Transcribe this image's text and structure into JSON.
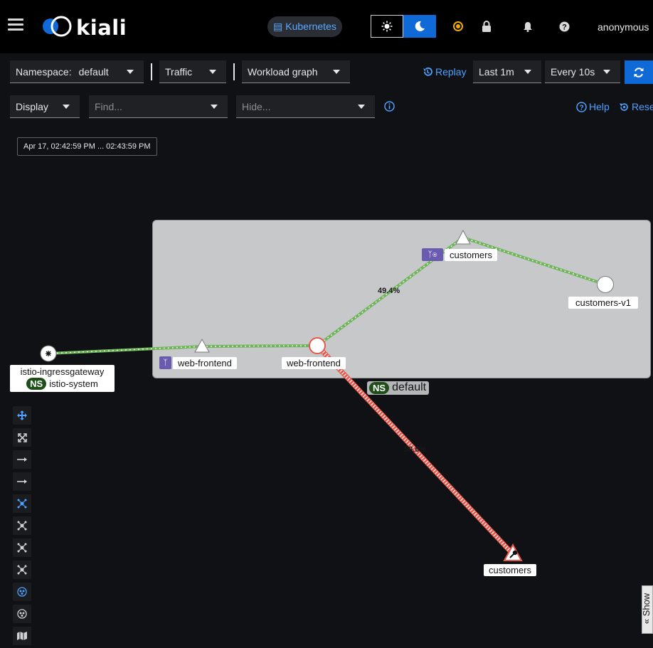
{
  "header": {
    "logo": "kiali",
    "cluster_label": "Kubernetes",
    "username": "anonymous",
    "icons": [
      "menu-icon",
      "sun-icon",
      "moon-icon",
      "status-icon",
      "lock-icon",
      "bell-icon",
      "help-icon"
    ],
    "accent": "#0f6ad8"
  },
  "toolbar1": {
    "namespace_label": "Namespace:",
    "namespace_value": "default",
    "traffic_label": "Traffic",
    "graph_type": "Workload graph",
    "replay_label": "Replay",
    "duration": "Last 1m",
    "refresh_interval": "Every 10s"
  },
  "toolbar2": {
    "display_label": "Display",
    "find_placeholder": "Find...",
    "hide_placeholder": "Hide...",
    "help_label": "Help",
    "reset_label": "Rese"
  },
  "graph": {
    "time_range": "Apr 17, 02:42:59 PM ... 02:43:59 PM",
    "namespace_box_label": "default",
    "ns_badge": "NS",
    "nodes": {
      "ingress_name": "istio-ingressgateway",
      "ingress_namespace": "istio-system",
      "web_frontend_service": "web-frontend",
      "web_frontend_workload": "web-frontend",
      "customers_service": "customers",
      "customers_v1": "customers-v1",
      "customers_external": "customers"
    },
    "edges": {
      "to_customers_label": "49.4%",
      "to_external_label": "50.6%"
    },
    "colors": {
      "healthy_edge": "#6fb35a",
      "error_edge": "#e8564a",
      "namespace_box": "#c7c8ca"
    }
  },
  "legend_tab": "Show"
}
